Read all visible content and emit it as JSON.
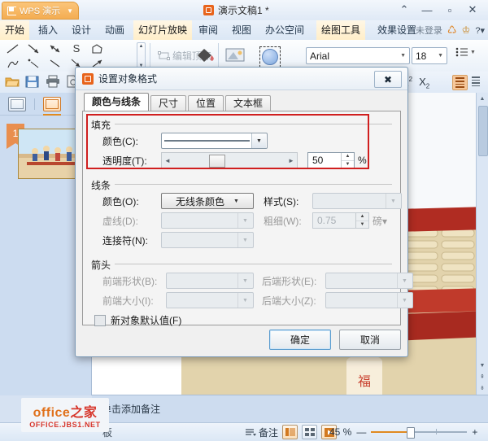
{
  "window": {
    "app_tab": "WPS 演示",
    "document_title": "演示文稿1 *",
    "buttons": {
      "collapse": "⌃",
      "minimize": "—",
      "maximize": "▫",
      "close": "✕"
    }
  },
  "ribbon": {
    "tabs": [
      {
        "label": "开始",
        "active": false
      },
      {
        "label": "插入",
        "active": false
      },
      {
        "label": "设计",
        "active": false
      },
      {
        "label": "动画",
        "active": false
      },
      {
        "label": "幻灯片放映",
        "active": true
      },
      {
        "label": "审阅",
        "active": false
      },
      {
        "label": "视图",
        "active": false
      },
      {
        "label": "办公空间",
        "active": false
      },
      {
        "label": "绘图工具",
        "active": true
      },
      {
        "label": "效果设置",
        "active": false
      }
    ],
    "account": "未登录",
    "help": "?"
  },
  "toolbar": {
    "edit_vertex": "编辑顶点",
    "font_name": "Arial",
    "font_size": "18"
  },
  "left_panel": {
    "slide_number": "1"
  },
  "notes": {
    "placeholder": "单击添加备注"
  },
  "statusbar": {
    "left_text": "板",
    "notes_label": "备注",
    "zoom_label": "45 %",
    "zoom_out": "—",
    "zoom_in": "+"
  },
  "watermark": {
    "line1_a": "office",
    "line1_b": "之家",
    "line2": "OFFICE.JBS1.NET"
  },
  "dialog": {
    "title": "设置对象格式",
    "close_glyph": "✖",
    "tabs": [
      {
        "label": "颜色与线条",
        "active": true
      },
      {
        "label": "尺寸",
        "active": false
      },
      {
        "label": "位置",
        "active": false
      },
      {
        "label": "文本框",
        "active": false
      }
    ],
    "fill": {
      "group_label": "填充",
      "color_label": "颜色(C):",
      "color_value": "",
      "transparency_label": "透明度(T):",
      "transparency_value": "50",
      "transparency_unit": "%",
      "slider_left": "◄",
      "slider_right": "►"
    },
    "line": {
      "group_label": "线条",
      "color_label": "颜色(O):",
      "color_value": "无线条颜色",
      "style_label": "样式(S):",
      "style_value": "",
      "dash_label": "虚线(D):",
      "dash_value": "",
      "weight_label": "粗细(W):",
      "weight_value": "0.75",
      "weight_unit": "磅",
      "connector_label": "连接符(N):",
      "connector_value": ""
    },
    "arrows": {
      "group_label": "箭头",
      "begin_style_label": "前端形状(B):",
      "begin_style_value": "",
      "end_style_label": "后端形状(E):",
      "end_style_value": "",
      "begin_size_label": "前端大小(I):",
      "begin_size_value": "",
      "end_size_label": "后端大小(Z):",
      "end_size_value": "",
      "default_checkbox_label": "新对象默认值(F)",
      "default_checkbox_checked": false
    },
    "ok_label": "确定",
    "cancel_label": "取消"
  },
  "colors": {
    "accent_orange": "#e08a20",
    "highlight_red": "#d01f1f",
    "panel_blue": "#ccdcf0",
    "dialog_gray": "#f0f0f0",
    "watermark_red": "#d7362c"
  }
}
